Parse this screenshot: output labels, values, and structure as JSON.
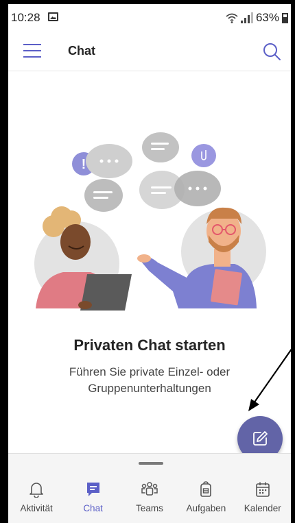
{
  "status_bar": {
    "time": "10:28",
    "battery": "63%",
    "icons": [
      "gallery-icon",
      "wifi-icon",
      "signal-icon",
      "battery-icon"
    ]
  },
  "header": {
    "title": "Chat",
    "menu_icon": "hamburger-icon",
    "search_icon": "search-icon"
  },
  "empty_state": {
    "title": "Privaten Chat starten",
    "description": "Führen Sie private Einzel- oder Gruppenunterhaltungen"
  },
  "fab": {
    "icon": "compose-icon"
  },
  "bottom_nav": {
    "items": [
      {
        "label": "Aktivität",
        "icon": "bell-icon",
        "active": false
      },
      {
        "label": "Chat",
        "icon": "chat-icon",
        "active": true
      },
      {
        "label": "Teams",
        "icon": "teams-icon",
        "active": false
      },
      {
        "label": "Aufgaben",
        "icon": "tasks-icon",
        "active": false
      },
      {
        "label": "Kalender",
        "icon": "calendar-icon",
        "active": false
      }
    ]
  },
  "colors": {
    "accent": "#5b5fc7",
    "fab": "#6264a7",
    "bubble_purple": "#8f8fd8",
    "bubble_gray": "#c8c8c8",
    "person_pink": "#e07b84",
    "person_purple": "#7d80d1"
  }
}
